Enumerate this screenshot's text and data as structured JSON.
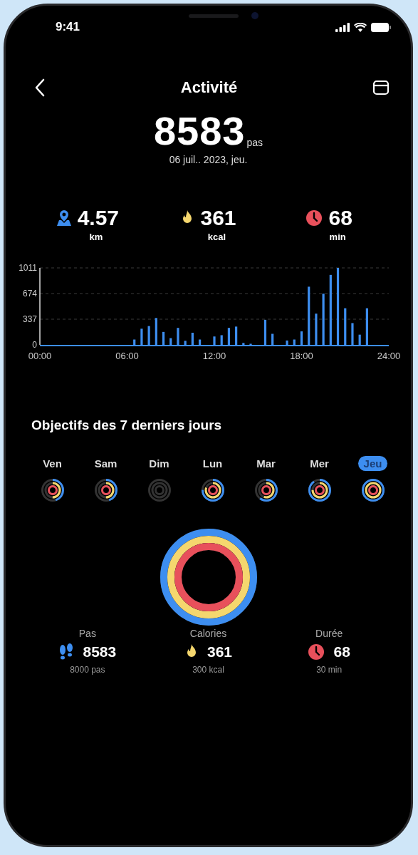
{
  "status_bar": {
    "time": "9:41"
  },
  "header": {
    "title": "Activité"
  },
  "summary": {
    "steps": "8583",
    "unit": "pas",
    "date": "06 juil.. 2023, jeu."
  },
  "stats": [
    {
      "kind": "distance",
      "value": "4.57",
      "unit": "km"
    },
    {
      "kind": "calories",
      "value": "361",
      "unit": "kcal"
    },
    {
      "kind": "duration",
      "value": "68",
      "unit": "min"
    }
  ],
  "chart": {
    "chart_data": {
      "type": "bar",
      "x": [
        0,
        0.5,
        1,
        1.5,
        2,
        2.5,
        3,
        3.5,
        4,
        4.5,
        5,
        5.5,
        6,
        6.5,
        7,
        7.5,
        8,
        8.5,
        9,
        9.5,
        10,
        10.5,
        11,
        11.5,
        12,
        12.5,
        13,
        13.5,
        14,
        14.5,
        15,
        15.5,
        16,
        16.5,
        17,
        17.5,
        18,
        18.5,
        19,
        19.5,
        20,
        20.5,
        21,
        21.5,
        22,
        22.5,
        23,
        23.5
      ],
      "values": [
        0,
        0,
        0,
        0,
        0,
        0,
        0,
        0,
        0,
        0,
        0,
        0,
        0,
        70,
        212,
        247,
        353,
        170,
        88,
        223,
        53,
        159,
        70,
        0,
        110,
        127,
        223,
        240,
        25,
        14,
        0,
        329,
        145,
        0,
        57,
        70,
        177,
        764,
        410,
        672,
        919,
        1011,
        481,
        286,
        134,
        481,
        0,
        0
      ],
      "xlim": [
        0,
        24
      ],
      "ylim": [
        0,
        1011
      ],
      "xticks": [
        {
          "value": 0,
          "label": "00:00"
        },
        {
          "value": 6,
          "label": "06:00"
        },
        {
          "value": 12,
          "label": "12:00"
        },
        {
          "value": 18,
          "label": "18:00"
        },
        {
          "value": 24,
          "label": "24:00"
        }
      ],
      "yticks": [
        0,
        337,
        674,
        1011
      ]
    }
  },
  "goals_title": "Objectifs des 7 derniers jours",
  "days": [
    {
      "label": "Ven",
      "selected": false
    },
    {
      "label": "Sam",
      "selected": false
    },
    {
      "label": "Dim",
      "selected": false
    },
    {
      "label": "Lun",
      "selected": false
    },
    {
      "label": "Mar",
      "selected": false
    },
    {
      "label": "Mer",
      "selected": false
    },
    {
      "label": "Jeu",
      "selected": true
    }
  ],
  "big_ring": [
    {
      "kind": "distance",
      "level": 1
    },
    {
      "kind": "calories",
      "level": 1
    },
    {
      "kind": "duration",
      "level": 1
    }
  ],
  "goals": [
    {
      "kind": "steps",
      "label": "Pas",
      "value": "8583",
      "target": "8000 pas"
    },
    {
      "kind": "calories",
      "label": "Calories",
      "value": "361",
      "target": "300 kcal"
    },
    {
      "kind": "duration",
      "label": "Durée",
      "value": "68",
      "target": "30 min"
    }
  ]
}
